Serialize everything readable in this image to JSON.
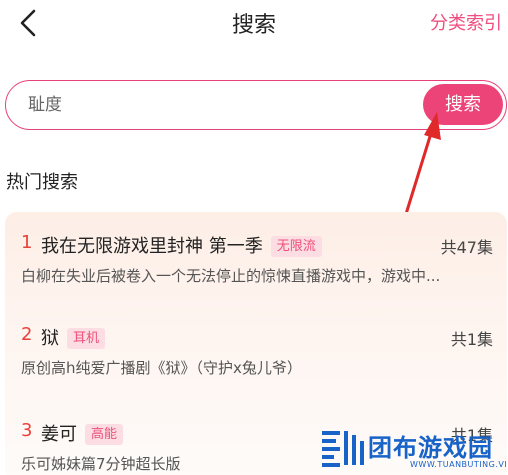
{
  "header": {
    "back_icon": "chevron-left-icon",
    "title": "搜索",
    "index_link": "分类索引"
  },
  "search": {
    "value": "",
    "placeholder": "耻度",
    "button_label": "搜索"
  },
  "hot_search": {
    "title": "热门搜索",
    "items": [
      {
        "rank": "1",
        "name": "我在无限游戏里封神 第一季",
        "tag": "无限流",
        "count": "共47集",
        "desc": "白柳在失业后被卷入一个无法停止的惊悚直播游戏中，游戏中..."
      },
      {
        "rank": "2",
        "name": "狱",
        "tag": "耳机",
        "count": "共1集",
        "desc": "原创高h纯爱广播剧《狱》（守护x兔儿爷）"
      },
      {
        "rank": "3",
        "name": "姜可",
        "tag": "高能",
        "count": "共1集",
        "desc": "乐可姊妹篇7分钟超长版"
      }
    ]
  },
  "annotation": {
    "arrow_color": "#e02a2a"
  },
  "watermark": {
    "text": "团布游戏园",
    "url": "WWW.TUANBUTING.VIP",
    "color": "#1763c8"
  },
  "colors": {
    "accent": "#ec4479",
    "rank": "#e8423a",
    "tag_bg": "#fbdde3"
  }
}
